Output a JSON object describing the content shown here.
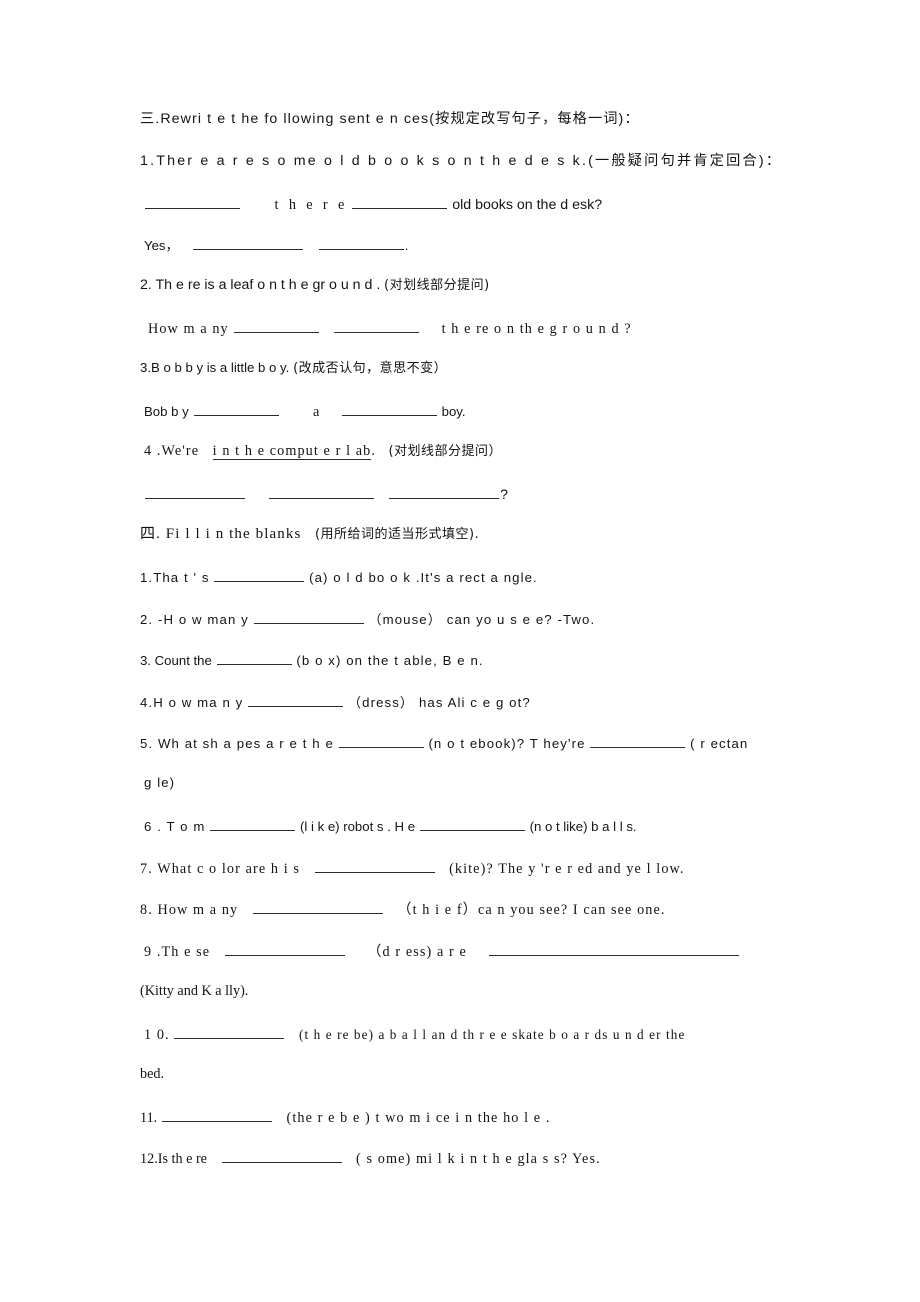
{
  "document": {
    "type": "english-grammar-worksheet",
    "background_color": "#ffffff",
    "text_color": "#141414"
  },
  "sections": [
    {
      "id": "section-three",
      "heading": "三.Rewri t e    t he   fo llowing   sent e n ces(按规定改写句子，每格一词)：",
      "heading_parts": {
        "marker": "三.",
        "english": "Rewri t e    t he   fo llowing   sent e n ces",
        "chinese": "(按规定改写句子，每格一词)："
      },
      "items": [
        {
          "number": "1.",
          "prompt": "Ther e  a r e   s o me   o l d  b o o k s  o n    t h e  d e s k.",
          "instruction": "(一般疑问句并肯定回合)：",
          "answer_lines": [
            "__________   t h e r e __________ old   books on the  d esk?",
            "Yes，___________ _________."
          ]
        },
        {
          "number": "2.",
          "prompt": "Th e re is a leaf  o n   t h e gr o u n d .",
          "instruction": "(对划线部分提问)",
          "answer_lines": [
            "How   m a ny_________  _________   t h e re o n  th e   g r o u n d ?"
          ]
        },
        {
          "number": "3.",
          "prompt": "B o b b y is a little   b  o y.",
          "instruction": "(改成否认句，意思不变）",
          "answer_lines": [
            "Bob b y__________    a   __________ boy."
          ]
        },
        {
          "number": "4.",
          "prompt": "We're ",
          "underlined_phrase": "i n t h e comput e r  l ab",
          "prompt_tail": ".",
          "instruction": "(对划线部分提问）",
          "answer_lines": [
            "__________  __________ __________?"
          ]
        }
      ]
    },
    {
      "id": "section-four",
      "heading": "四. Fi l l  i n the  blanks (用所给词的适当形式填空).",
      "heading_parts": {
        "marker": "四.",
        "english": " Fi l l  i n the  blanks ",
        "chinese": "(用所给词的适当形式填空)."
      },
      "items": [
        {
          "number": "1.",
          "text_before": "Tha t ' s",
          "blank": "blank",
          "cue": "(a) o l d bo o  k .",
          "text_after": "It's a rect a ngle."
        },
        {
          "number": "2.",
          "text_before": "-H o w   man y",
          "blank": "blank",
          "cue": "（mouse）",
          "text_after": "can yo u   s e e? -Two."
        },
        {
          "number": "3.",
          "text_before": "Count the",
          "blank": "blank",
          "cue": "(b o x)",
          "text_after": "on the  t able, B e n."
        },
        {
          "number": "4.",
          "text_before": "H o w  ma n y",
          "blank": "blank",
          "cue": "（dress）",
          "text_after": "has  Ali c e  g ot?"
        },
        {
          "number": "5.",
          "text_before": "Wh at sh a pes   a  r e t h e",
          "blank": "blank",
          "cue": "(n o t ebook)?",
          "text_middle": "T hey're",
          "blank2": "blank",
          "cue2": "( r ectan",
          "wrapped_line": "g le)"
        },
        {
          "number": "6.",
          "text_before": "T o m",
          "blank": "blank",
          "cue": "(l i  k e) robot s . H e",
          "blank2": "blank",
          "cue2": "(n o t   like) b a l  l s."
        },
        {
          "number": "7.",
          "text_before": "What c o lor are h i s",
          "blank": "blank",
          "cue": "(kite)?",
          "text_after": "The y 'r e   r ed and ye l low."
        },
        {
          "number": "8.",
          "text_before": "How m a ny",
          "blank": "blank",
          "cue": "（t h i e f）ca n  you see?",
          "text_after": "I  can see one."
        },
        {
          "number": "9.",
          "text_before": "Th e se",
          "blank": "blank",
          "cue": "（d r ess) a r  e",
          "blank2": "blank",
          "wrapped_line": "(Kitty and K a lly)."
        },
        {
          "number": "10.",
          "blank": "blank",
          "cue": "(t h e re   be) a b a l l  an d  th r e e  skate b o a  r ds u n  d er the",
          "wrapped_line": "bed."
        },
        {
          "number": "11.",
          "blank": "blank",
          "cue": "(the r e   b e )   t wo m i ce i n   the ho l  e ."
        },
        {
          "number": "12.",
          "text_before": "Is th e re",
          "blank": "blank",
          "cue": "( s ome)   mi l k  i n  t h e  gla s s? Yes."
        }
      ]
    }
  ],
  "lines": {
    "l01": "三.Rewri t e    t he   fo llowing   sent e n ces(按规定改写句子，每格一词)：",
    "l02": "1.Ther e  a r e   s o me   o l d  b o o k s  o n    t h e  d e s k.(一般疑问句并肯定回合)：",
    "l03_a": "t h e r e",
    "l03_b": "old   books on the  d esk?",
    "l04": "Yes，",
    "l05_a": "2. Th e re is a leaf  o n   t h e gr o u n d .",
    "l05_b": "(对划线部分提问)",
    "l06_a": "How   m a ny",
    "l06_b": "t h e re o n  th e   g r o u n d ?",
    "l07_a": "3.B o b b y is a little   b  o y.",
    "l07_b": "(改成否认句，意思不变）",
    "l08_a": "Bob b y",
    "l08_b": "a",
    "l08_c": "boy.",
    "l09_a": "4 .We're",
    "l09_b": "i n  t h e  comput e r   l ab",
    "l09_c": ".",
    "l09_d": "(对划线部分提问）",
    "l10": "?",
    "l11_a": "四. Fi l l  i n the  blanks",
    "l11_b": "(用所给词的适当形式填空).",
    "l12_a": "1.Tha t ' s",
    "l12_b": "(a) o l d bo o  k .It's a rect a ngle.",
    "l13_a": "2. -H o w   man y",
    "l13_b": "（mouse）    can yo u   s e e? -Two.",
    "l14_a": "3. Count the",
    "l14_b": "(b o x)    on the  t able, B e n.",
    "l15_a": "4.H o w  ma n y",
    "l15_b": "（dress）  has  Ali c e  g ot?",
    "l16_a": "5. Wh at sh a pes   a  r e t h e",
    "l16_b": "(n o t ebook)?   T hey're",
    "l16_c": "( r ectan",
    "l17": "g le)",
    "l18_a": "6 . T o m",
    "l18_b": "(l i  k e) robot s . H e",
    "l18_c": "(n o t   like) b a l  l s.",
    "l19_a": "7. What c o lor are h i s",
    "l19_b": "(kite)?   The y 'r e   r ed and ye l low.",
    "l20_a": "8. How m a ny",
    "l20_b": "（t h i e f）ca n  you see?  I  can see one.",
    "l21_a": "9 .Th e se",
    "l21_b": "（d r ess) a r  e",
    "l22": "(Kitty and K a lly).",
    "l23_a": "1 0.",
    "l23_b": "(t h e re   be) a b a l l  an d  th r e e  skate b o a  r ds u n  d er the",
    "l24": "bed.",
    "l25_a": "11.",
    "l25_b": "(the r e   b e )   t wo m i ce i n   the ho l  e .",
    "l26_a": "12.Is th e re",
    "l26_b": "( s ome)   mi l k  i n  t h e  gla s s? Yes."
  }
}
